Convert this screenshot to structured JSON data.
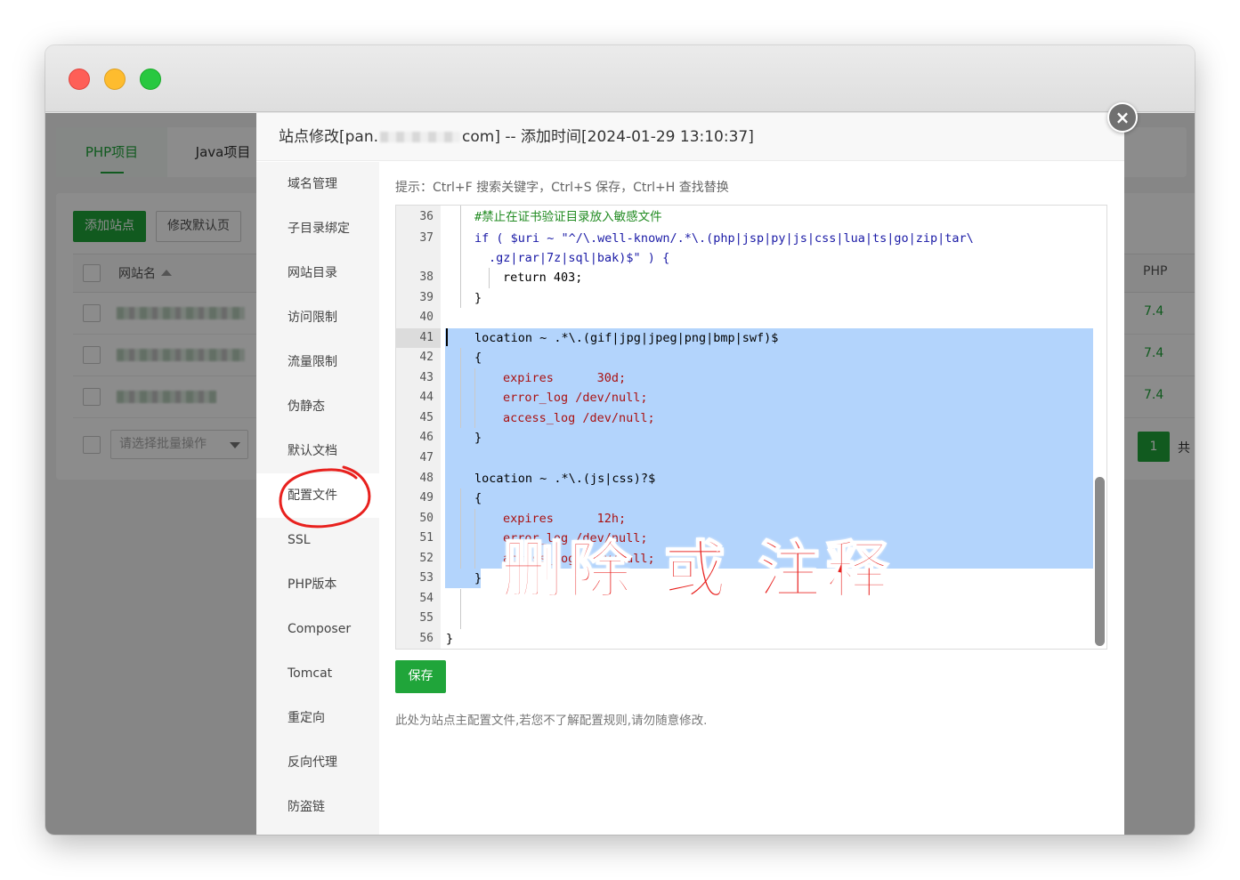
{
  "page": {
    "project_tabs": [
      {
        "label": "PHP项目",
        "active": true
      },
      {
        "label": "Java项目",
        "active": false
      }
    ],
    "toolbar": {
      "add_site_label": "添加站点",
      "edit_default_label": "修改默认页"
    },
    "table": {
      "name_header": "网站名",
      "php_header": "PHP",
      "rows": [
        {
          "name": "",
          "php": "7.4"
        },
        {
          "name": "",
          "php": "7.4"
        },
        {
          "name": "",
          "php": "7.4"
        }
      ]
    },
    "batch_placeholder": "请选择批量操作",
    "pagination": {
      "current": "1",
      "total_prefix": "共"
    }
  },
  "modal": {
    "title_prefix": "站点修改[pan.",
    "title_redacted": "",
    "title_suffix": "com] -- 添加时间[2024-01-29 13:10:37]",
    "close_label": "×",
    "active_menu": "配置文件",
    "menu": [
      "域名管理",
      "子目录绑定",
      "网站目录",
      "访问限制",
      "流量限制",
      "伪静态",
      "默认文档",
      "配置文件",
      "SSL",
      "PHP版本",
      "Composer",
      "Tomcat",
      "重定向",
      "反向代理",
      "防盗链"
    ],
    "hint": "提示：Ctrl+F 搜索关键字，Ctrl+S 保存，Ctrl+H 查找替换",
    "editor": {
      "current_line": 41,
      "selected_lines": [
        41,
        53
      ],
      "lines": [
        {
          "n": "36",
          "text": "#禁止在证书验证目录放入敏感文件"
        },
        {
          "n": "37",
          "text": "if ( $uri ~ \"^/\\.well-known/.*\\.(php|jsp|py|js|css|lua|ts|go|zip|tar\\"
        },
        {
          "n": "",
          "text": ".gz|rar|7z|sql|bak)$\" ) {"
        },
        {
          "n": "38",
          "text": "return 403;"
        },
        {
          "n": "39",
          "text": "}"
        },
        {
          "n": "40",
          "text": ""
        },
        {
          "n": "41",
          "text": "location ~ .*\\.(gif|jpg|jpeg|png|bmp|swf)$"
        },
        {
          "n": "42",
          "text": "{"
        },
        {
          "n": "43",
          "text": "expires      30d;"
        },
        {
          "n": "44",
          "text": "error_log /dev/null;"
        },
        {
          "n": "45",
          "text": "access_log /dev/null;"
        },
        {
          "n": "46",
          "text": "}"
        },
        {
          "n": "47",
          "text": ""
        },
        {
          "n": "48",
          "text": "location ~ .*\\.(js|css)?$"
        },
        {
          "n": "49",
          "text": "{"
        },
        {
          "n": "50",
          "text": "expires      12h;"
        },
        {
          "n": "51",
          "text": "error_log /dev/null;"
        },
        {
          "n": "52",
          "text": "access_log /dev/null;"
        },
        {
          "n": "53",
          "text": "}"
        },
        {
          "n": "54",
          "text": ""
        },
        {
          "n": "55",
          "text": ""
        },
        {
          "n": "56",
          "text": "}"
        }
      ]
    },
    "annotation": "删除 或 注释",
    "save_label": "保存",
    "footnote": "此处为站点主配置文件,若您不了解配置规则,请勿随意修改."
  }
}
